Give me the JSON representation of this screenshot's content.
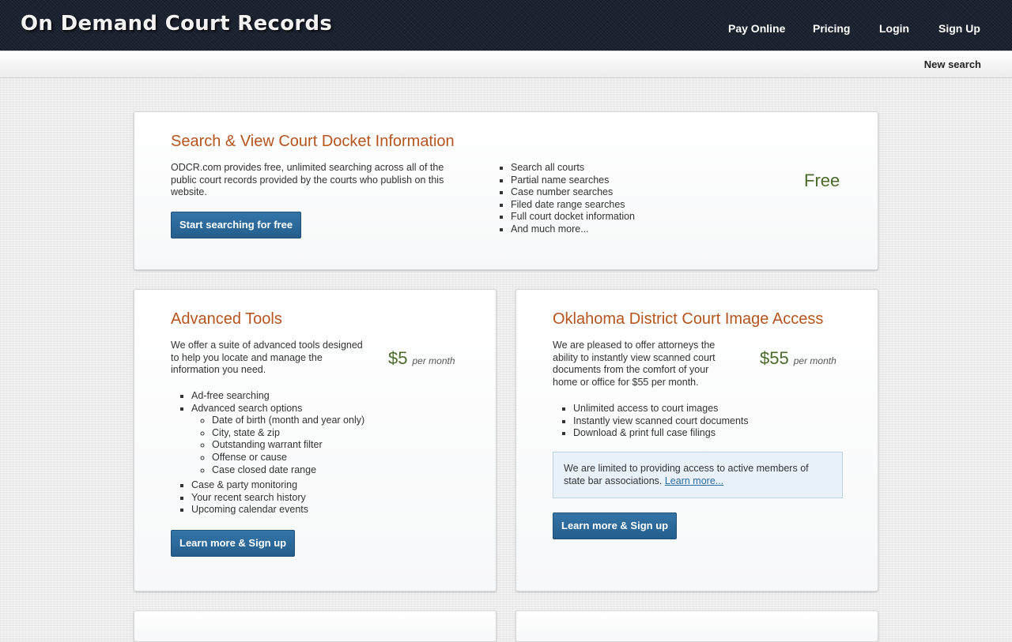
{
  "header": {
    "logo": "On Demand Court Records",
    "nav": [
      {
        "label": "Pay Online"
      },
      {
        "label": "Pricing"
      },
      {
        "label": "Login"
      },
      {
        "label": "Sign Up"
      }
    ]
  },
  "subbar": {
    "new_search": "New search"
  },
  "free_card": {
    "title": "Search & View Court Docket Information",
    "description": "ODCR.com provides free, unlimited searching across all of the public court records provided by the courts who publish on this website.",
    "button": "Start searching for free",
    "features": [
      "Search all courts",
      "Partial name searches",
      "Case number searches",
      "Filed date range searches",
      "Full court docket information",
      "And much more..."
    ],
    "price": "Free"
  },
  "advanced_card": {
    "title": "Advanced Tools",
    "description": "We offer a suite of advanced tools designed to help you locate and manage the information you need.",
    "price": "$5",
    "price_unit": "per month",
    "features": {
      "item1": "Ad-free searching",
      "item2": "Advanced search options",
      "sub": [
        "Date of birth (month and year only)",
        "City, state & zip",
        "Outstanding warrant filter",
        "Offense or cause",
        "Case closed date range"
      ],
      "item3": "Case & party monitoring",
      "item4": "Your recent search history",
      "item5": "Upcoming calendar events"
    },
    "button": "Learn more & Sign up"
  },
  "image_card": {
    "title": "Oklahoma District Court Image Access",
    "description": "We are pleased to offer attorneys the ability to instantly view scanned court documents from the comfort of your home or office for $55 per month.",
    "price": "$55",
    "price_unit": "per month",
    "features": [
      "Unlimited access to court images",
      "Instantly view scanned court documents",
      "Download & print full case filings"
    ],
    "notice_text": "We are limited to providing access to active members of state bar associations.",
    "notice_link": "Learn more...",
    "button": "Learn more & Sign up"
  }
}
